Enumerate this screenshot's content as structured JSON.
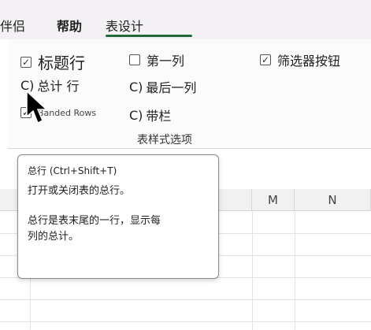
{
  "tabs": {
    "items": [
      {
        "label": "伴侣"
      },
      {
        "label": "帮助"
      },
      {
        "label": "表设计"
      }
    ],
    "active_color": "#1e6b3a"
  },
  "ribbon": {
    "options": {
      "header_row": {
        "label": "标题行",
        "checked": true
      },
      "total_row": {
        "label": "总计 行",
        "prefix": "C)",
        "checked": false
      },
      "banded_rows": {
        "label": "Banded Rows",
        "checked": true
      },
      "first_column": {
        "label": "第一列",
        "checked": false
      },
      "last_column": {
        "label": "最后一列",
        "prefix": "C)",
        "checked": false
      },
      "banded_columns": {
        "label": "带栏",
        "prefix": "C)",
        "checked": false
      },
      "filter_button": {
        "label": "筛选器按钮",
        "checked": true
      }
    },
    "group_label": "表样式选项"
  },
  "tooltip": {
    "title": "总行 (Ctrl+Shift+T)",
    "para1": "打开或关闭表的总行。",
    "para2": "总行是表末尾的一行，显示每列的总计。"
  },
  "grid": {
    "columns": [
      "M",
      "N"
    ]
  }
}
